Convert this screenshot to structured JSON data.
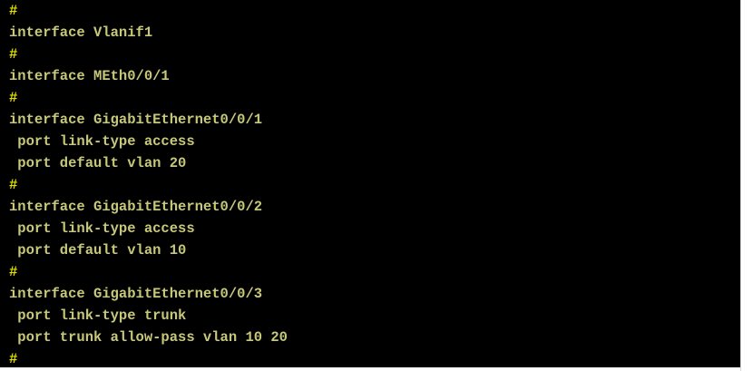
{
  "terminal": {
    "lines": [
      {
        "text": "#",
        "kind": "hash"
      },
      {
        "text": "interface Vlanif1",
        "kind": "cmd"
      },
      {
        "text": "#",
        "kind": "hash"
      },
      {
        "text": "interface MEth0/0/1",
        "kind": "cmd"
      },
      {
        "text": "#",
        "kind": "hash"
      },
      {
        "text": "interface GigabitEthernet0/0/1",
        "kind": "cmd"
      },
      {
        "text": " port link-type access",
        "kind": "cmd"
      },
      {
        "text": " port default vlan 20",
        "kind": "cmd"
      },
      {
        "text": "#",
        "kind": "hash"
      },
      {
        "text": "interface GigabitEthernet0/0/2",
        "kind": "cmd"
      },
      {
        "text": " port link-type access",
        "kind": "cmd"
      },
      {
        "text": " port default vlan 10",
        "kind": "cmd"
      },
      {
        "text": "#",
        "kind": "hash"
      },
      {
        "text": "interface GigabitEthernet0/0/3",
        "kind": "cmd"
      },
      {
        "text": " port link-type trunk",
        "kind": "cmd"
      },
      {
        "text": " port trunk allow-pass vlan 10 20",
        "kind": "cmd"
      },
      {
        "text": "#",
        "kind": "hash"
      }
    ],
    "colors": {
      "background": "#000000",
      "text": "#c8c87a",
      "hash": "#e0e000"
    }
  }
}
